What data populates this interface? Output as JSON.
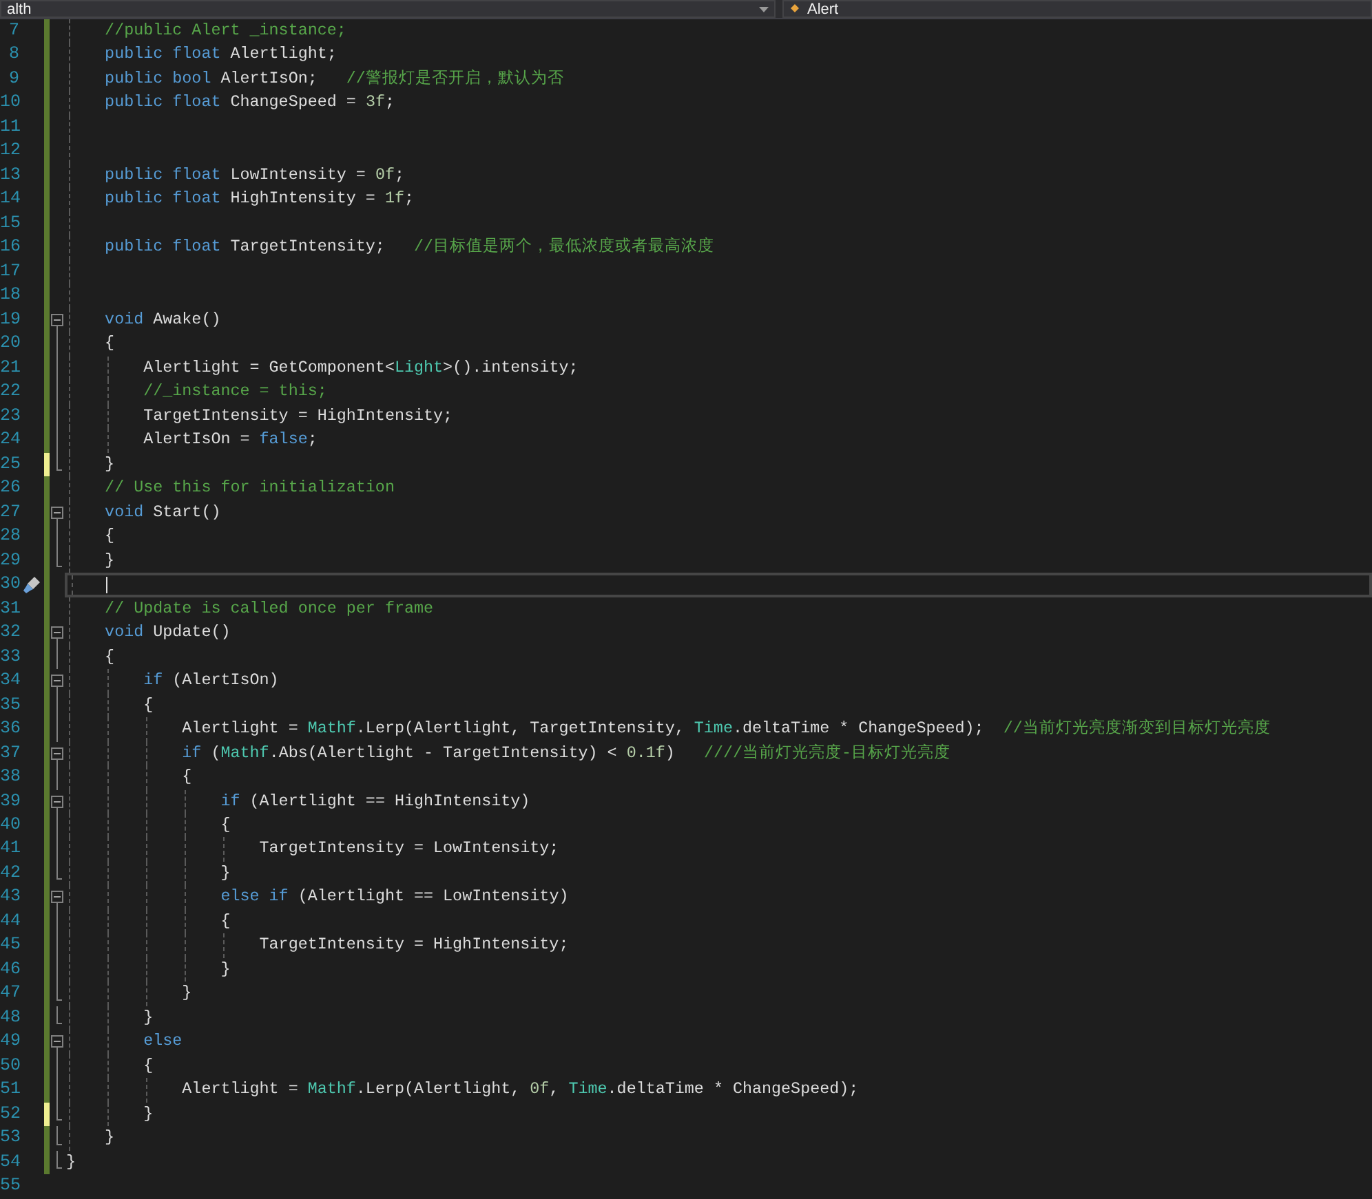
{
  "navigation_bar": {
    "left_dropdown": "alth",
    "right_dropdown": "Alert"
  },
  "lines": [
    {
      "number": "7",
      "tracked": true,
      "unsaved": false,
      "collapsible": false,
      "in_block": false,
      "block_end": false,
      "current": false,
      "tokens": [
        {
          "kind": "comment",
          "text": "    //public Alert _instance;"
        }
      ]
    },
    {
      "number": "8",
      "tracked": true,
      "unsaved": false,
      "collapsible": false,
      "in_block": false,
      "block_end": false,
      "current": false,
      "tokens": [
        {
          "kind": "keyword",
          "text": "    public float"
        },
        {
          "kind": "plain",
          "text": " Alertlight;"
        }
      ]
    },
    {
      "number": "9",
      "tracked": true,
      "unsaved": false,
      "collapsible": false,
      "in_block": false,
      "block_end": false,
      "current": false,
      "tokens": [
        {
          "kind": "keyword",
          "text": "    public bool"
        },
        {
          "kind": "plain",
          "text": " AlertIsOn;   "
        },
        {
          "kind": "comment",
          "text": "//警报灯是否开启，默认为否"
        }
      ]
    },
    {
      "number": "10",
      "tracked": true,
      "unsaved": false,
      "collapsible": false,
      "in_block": false,
      "block_end": false,
      "current": false,
      "tokens": [
        {
          "kind": "keyword",
          "text": "    public float"
        },
        {
          "kind": "plain",
          "text": " ChangeSpeed = "
        },
        {
          "kind": "number",
          "text": "3f"
        },
        {
          "kind": "plain",
          "text": ";"
        }
      ]
    },
    {
      "number": "11",
      "tracked": true,
      "unsaved": false,
      "collapsible": false,
      "in_block": false,
      "block_end": false,
      "current": false
    },
    {
      "number": "12",
      "tracked": true,
      "unsaved": false,
      "collapsible": false,
      "in_block": false,
      "block_end": false,
      "current": false
    },
    {
      "number": "13",
      "tracked": true,
      "unsaved": false,
      "collapsible": false,
      "in_block": false,
      "block_end": false,
      "current": false,
      "tokens": [
        {
          "kind": "keyword",
          "text": "    public float"
        },
        {
          "kind": "plain",
          "text": " LowIntensity = "
        },
        {
          "kind": "number",
          "text": "0f"
        },
        {
          "kind": "plain",
          "text": ";"
        }
      ]
    },
    {
      "number": "14",
      "tracked": true,
      "unsaved": false,
      "collapsible": false,
      "in_block": false,
      "block_end": false,
      "current": false,
      "tokens": [
        {
          "kind": "keyword",
          "text": "    public float"
        },
        {
          "kind": "plain",
          "text": " HighIntensity = "
        },
        {
          "kind": "number",
          "text": "1f"
        },
        {
          "kind": "plain",
          "text": ";"
        }
      ]
    },
    {
      "number": "15",
      "tracked": true,
      "unsaved": false,
      "collapsible": false,
      "in_block": false,
      "block_end": false,
      "current": false
    },
    {
      "number": "16",
      "tracked": true,
      "unsaved": false,
      "collapsible": false,
      "in_block": false,
      "block_end": false,
      "current": false,
      "tokens": [
        {
          "kind": "keyword",
          "text": "    public float"
        },
        {
          "kind": "plain",
          "text": " TargetIntensity;   "
        },
        {
          "kind": "comment",
          "text": "//目标值是两个，最低浓度或者最高浓度"
        }
      ]
    },
    {
      "number": "17",
      "tracked": true,
      "unsaved": false,
      "collapsible": false,
      "in_block": false,
      "block_end": false,
      "current": false
    },
    {
      "number": "18",
      "tracked": true,
      "unsaved": false,
      "collapsible": false,
      "in_block": false,
      "block_end": false,
      "current": false
    },
    {
      "number": "19",
      "tracked": true,
      "unsaved": false,
      "collapsible": true,
      "in_block": false,
      "block_end": false,
      "current": false,
      "tokens": [
        {
          "kind": "keyword",
          "text": "    void"
        },
        {
          "kind": "plain",
          "text": " Awake()"
        }
      ]
    },
    {
      "number": "20",
      "tracked": true,
      "unsaved": false,
      "collapsible": false,
      "in_block": true,
      "block_end": false,
      "current": false,
      "tokens": [
        {
          "kind": "plain",
          "text": "    {"
        }
      ]
    },
    {
      "number": "21",
      "tracked": true,
      "unsaved": false,
      "collapsible": false,
      "in_block": true,
      "block_end": false,
      "current": false,
      "tokens": [
        {
          "kind": "plain",
          "text": "        Alertlight = GetComponent<"
        },
        {
          "kind": "type",
          "text": "Light"
        },
        {
          "kind": "plain",
          "text": ">().intensity;"
        }
      ]
    },
    {
      "number": "22",
      "tracked": true,
      "unsaved": false,
      "collapsible": false,
      "in_block": true,
      "block_end": false,
      "current": false,
      "tokens": [
        {
          "kind": "comment",
          "text": "        //_instance = this;"
        }
      ]
    },
    {
      "number": "23",
      "tracked": true,
      "unsaved": false,
      "collapsible": false,
      "in_block": true,
      "block_end": false,
      "current": false,
      "tokens": [
        {
          "kind": "plain",
          "text": "        TargetIntensity = HighIntensity;"
        }
      ]
    },
    {
      "number": "24",
      "tracked": true,
      "unsaved": false,
      "collapsible": false,
      "in_block": true,
      "block_end": false,
      "current": false,
      "tokens": [
        {
          "kind": "plain",
          "text": "        AlertIsOn = "
        },
        {
          "kind": "keyword",
          "text": "false"
        },
        {
          "kind": "plain",
          "text": ";"
        }
      ]
    },
    {
      "number": "25",
      "tracked": true,
      "unsaved": true,
      "collapsible": false,
      "in_block": false,
      "block_end": true,
      "current": false,
      "tokens": [
        {
          "kind": "plain",
          "text": "    }"
        }
      ]
    },
    {
      "number": "26",
      "tracked": true,
      "unsaved": false,
      "collapsible": false,
      "in_block": false,
      "block_end": false,
      "current": false,
      "tokens": [
        {
          "kind": "comment",
          "text": "    // Use this for initialization"
        }
      ]
    },
    {
      "number": "27",
      "tracked": true,
      "unsaved": false,
      "collapsible": true,
      "in_block": false,
      "block_end": false,
      "current": false,
      "tokens": [
        {
          "kind": "keyword",
          "text": "    void"
        },
        {
          "kind": "plain",
          "text": " Start()"
        }
      ]
    },
    {
      "number": "28",
      "tracked": true,
      "unsaved": false,
      "collapsible": false,
      "in_block": true,
      "block_end": false,
      "current": false,
      "tokens": [
        {
          "kind": "plain",
          "text": "    {"
        }
      ]
    },
    {
      "number": "29",
      "tracked": true,
      "unsaved": false,
      "collapsible": false,
      "in_block": false,
      "block_end": true,
      "current": false,
      "tokens": [
        {
          "kind": "plain",
          "text": "    }"
        }
      ]
    },
    {
      "number": "30",
      "tracked": true,
      "unsaved": false,
      "collapsible": false,
      "in_block": false,
      "block_end": false,
      "current": true
    },
    {
      "number": "31",
      "tracked": true,
      "unsaved": false,
      "collapsible": false,
      "in_block": false,
      "block_end": false,
      "current": false,
      "tokens": [
        {
          "kind": "comment",
          "text": "    // Update is called once per frame"
        }
      ]
    },
    {
      "number": "32",
      "tracked": true,
      "unsaved": false,
      "collapsible": true,
      "in_block": false,
      "block_end": false,
      "current": false,
      "tokens": [
        {
          "kind": "keyword",
          "text": "    void"
        },
        {
          "kind": "plain",
          "text": " Update()"
        }
      ]
    },
    {
      "number": "33",
      "tracked": true,
      "unsaved": false,
      "collapsible": false,
      "in_block": true,
      "block_end": false,
      "current": false,
      "tokens": [
        {
          "kind": "plain",
          "text": "    {"
        }
      ]
    },
    {
      "number": "34",
      "tracked": true,
      "unsaved": false,
      "collapsible": true,
      "in_block": false,
      "block_end": false,
      "current": false,
      "tokens": [
        {
          "kind": "keyword",
          "text": "        if"
        },
        {
          "kind": "plain",
          "text": " (AlertIsOn)"
        }
      ]
    },
    {
      "number": "35",
      "tracked": true,
      "unsaved": false,
      "collapsible": false,
      "in_block": true,
      "block_end": false,
      "current": false,
      "tokens": [
        {
          "kind": "plain",
          "text": "        {"
        }
      ]
    },
    {
      "number": "36",
      "tracked": true,
      "unsaved": false,
      "collapsible": false,
      "in_block": true,
      "block_end": false,
      "current": false,
      "tokens": [
        {
          "kind": "plain",
          "text": "            Alertlight = "
        },
        {
          "kind": "type",
          "text": "Mathf"
        },
        {
          "kind": "plain",
          "text": ".Lerp(Alertlight, TargetIntensity, "
        },
        {
          "kind": "type",
          "text": "Time"
        },
        {
          "kind": "plain",
          "text": ".deltaTime * ChangeSpeed);  "
        },
        {
          "kind": "comment",
          "text": "//当前灯光亮度渐变到目标灯光亮度"
        }
      ]
    },
    {
      "number": "37",
      "tracked": true,
      "unsaved": false,
      "collapsible": true,
      "in_block": false,
      "block_end": false,
      "current": false,
      "tokens": [
        {
          "kind": "keyword",
          "text": "            if"
        },
        {
          "kind": "plain",
          "text": " ("
        },
        {
          "kind": "type",
          "text": "Mathf"
        },
        {
          "kind": "plain",
          "text": ".Abs(Alertlight - TargetIntensity) < "
        },
        {
          "kind": "number",
          "text": "0.1f"
        },
        {
          "kind": "plain",
          "text": ")   "
        },
        {
          "kind": "comment",
          "text": "////当前灯光亮度-目标灯光亮度"
        }
      ]
    },
    {
      "number": "38",
      "tracked": true,
      "unsaved": false,
      "collapsible": false,
      "in_block": true,
      "block_end": false,
      "current": false,
      "tokens": [
        {
          "kind": "plain",
          "text": "            {"
        }
      ]
    },
    {
      "number": "39",
      "tracked": true,
      "unsaved": false,
      "collapsible": true,
      "in_block": false,
      "block_end": false,
      "current": false,
      "tokens": [
        {
          "kind": "keyword",
          "text": "                if"
        },
        {
          "kind": "plain",
          "text": " (Alertlight == HighIntensity)"
        }
      ]
    },
    {
      "number": "40",
      "tracked": true,
      "unsaved": false,
      "collapsible": false,
      "in_block": true,
      "block_end": false,
      "current": false,
      "tokens": [
        {
          "kind": "plain",
          "text": "                {"
        }
      ]
    },
    {
      "number": "41",
      "tracked": true,
      "unsaved": false,
      "collapsible": false,
      "in_block": true,
      "block_end": false,
      "current": false,
      "tokens": [
        {
          "kind": "plain",
          "text": "                    TargetIntensity = LowIntensity;"
        }
      ]
    },
    {
      "number": "42",
      "tracked": true,
      "unsaved": false,
      "collapsible": false,
      "in_block": false,
      "block_end": true,
      "current": false,
      "tokens": [
        {
          "kind": "plain",
          "text": "                }"
        }
      ]
    },
    {
      "number": "43",
      "tracked": true,
      "unsaved": false,
      "collapsible": true,
      "in_block": false,
      "block_end": false,
      "current": false,
      "tokens": [
        {
          "kind": "keyword",
          "text": "                else if"
        },
        {
          "kind": "plain",
          "text": " (Alertlight == LowIntensity)"
        }
      ]
    },
    {
      "number": "44",
      "tracked": true,
      "unsaved": false,
      "collapsible": false,
      "in_block": true,
      "block_end": false,
      "current": false,
      "tokens": [
        {
          "kind": "plain",
          "text": "                {"
        }
      ]
    },
    {
      "number": "45",
      "tracked": true,
      "unsaved": false,
      "collapsible": false,
      "in_block": true,
      "block_end": false,
      "current": false,
      "tokens": [
        {
          "kind": "plain",
          "text": "                    TargetIntensity = HighIntensity;"
        }
      ]
    },
    {
      "number": "46",
      "tracked": true,
      "unsaved": false,
      "collapsible": false,
      "in_block": true,
      "block_end": false,
      "current": false,
      "tokens": [
        {
          "kind": "plain",
          "text": "                }"
        }
      ]
    },
    {
      "number": "47",
      "tracked": true,
      "unsaved": false,
      "collapsible": false,
      "in_block": false,
      "block_end": true,
      "current": false,
      "tokens": [
        {
          "kind": "plain",
          "text": "            }"
        }
      ]
    },
    {
      "number": "48",
      "tracked": true,
      "unsaved": false,
      "collapsible": false,
      "in_block": false,
      "block_end": true,
      "current": false,
      "tokens": [
        {
          "kind": "plain",
          "text": "        }"
        }
      ]
    },
    {
      "number": "49",
      "tracked": true,
      "unsaved": false,
      "collapsible": true,
      "in_block": false,
      "block_end": false,
      "current": false,
      "tokens": [
        {
          "kind": "keyword",
          "text": "        else"
        }
      ]
    },
    {
      "number": "50",
      "tracked": true,
      "unsaved": false,
      "collapsible": false,
      "in_block": true,
      "block_end": false,
      "current": false,
      "tokens": [
        {
          "kind": "plain",
          "text": "        {"
        }
      ]
    },
    {
      "number": "51",
      "tracked": true,
      "unsaved": false,
      "collapsible": false,
      "in_block": true,
      "block_end": false,
      "current": false,
      "tokens": [
        {
          "kind": "plain",
          "text": "            Alertlight = "
        },
        {
          "kind": "type",
          "text": "Mathf"
        },
        {
          "kind": "plain",
          "text": ".Lerp(Alertlight, "
        },
        {
          "kind": "number",
          "text": "0f"
        },
        {
          "kind": "plain",
          "text": ", "
        },
        {
          "kind": "type",
          "text": "Time"
        },
        {
          "kind": "plain",
          "text": ".deltaTime * ChangeSpeed);"
        }
      ]
    },
    {
      "number": "52",
      "tracked": true,
      "unsaved": true,
      "collapsible": false,
      "in_block": false,
      "block_end": true,
      "current": false,
      "tokens": [
        {
          "kind": "plain",
          "text": "        }"
        }
      ]
    },
    {
      "number": "53",
      "tracked": true,
      "unsaved": false,
      "collapsible": false,
      "in_block": false,
      "block_end": true,
      "current": false,
      "tokens": [
        {
          "kind": "plain",
          "text": "    }"
        }
      ]
    },
    {
      "number": "54",
      "tracked": true,
      "unsaved": false,
      "collapsible": false,
      "in_block": false,
      "block_end": true,
      "current": false,
      "tokens": [
        {
          "kind": "plain",
          "text": "}"
        }
      ]
    },
    {
      "number": "55",
      "tracked": false,
      "unsaved": false,
      "collapsible": false,
      "in_block": false,
      "block_end": false,
      "current": false
    }
  ]
}
